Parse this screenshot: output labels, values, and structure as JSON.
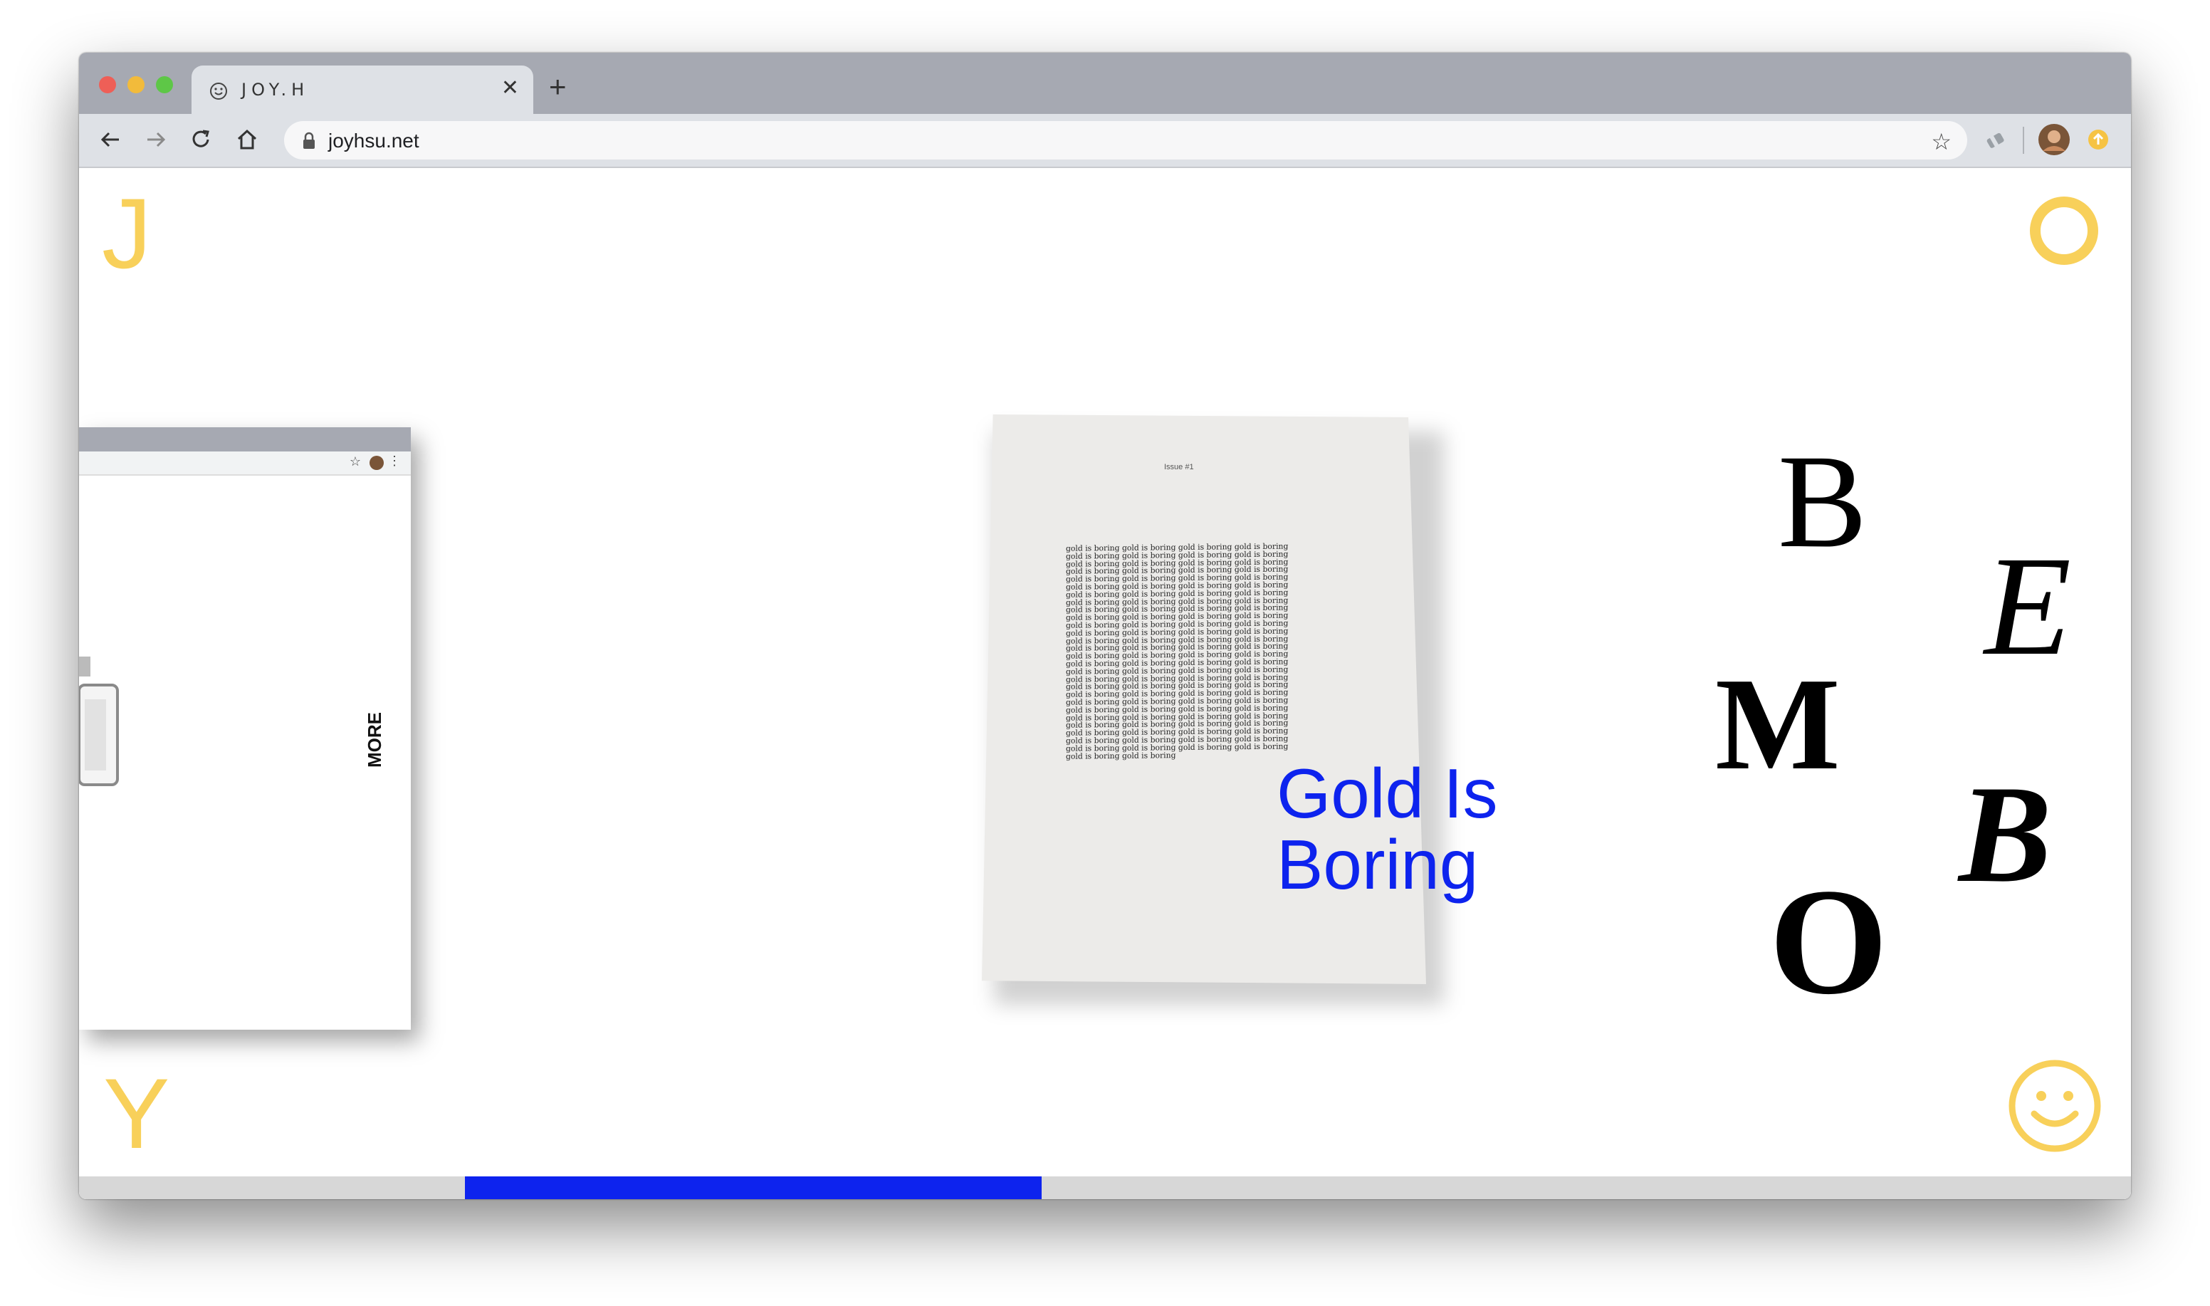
{
  "browser": {
    "tab_title": "JOY.H",
    "tab_favicon": "smiley-icon",
    "new_tab_label": "+",
    "close_label": "✕",
    "url": "joyhsu.net"
  },
  "colors": {
    "accent_yellow": "#f8d05a",
    "accent_blue": "#0d23ee",
    "progress_track": "#d7d7d7"
  },
  "page": {
    "corner_top_left": "J",
    "corner_bottom_left": "Y",
    "corner_top_right_icon": "ring-o-icon",
    "corner_bottom_right_icon": "smiley-icon"
  },
  "left_preview": {
    "side_label": "MORE"
  },
  "center_project": {
    "title": "Gold Is Boring",
    "issue_label": "Issue #1",
    "repeated_phrase": "gold is boring"
  },
  "right_project": {
    "letters": [
      "B",
      "E",
      "M",
      "B",
      "O"
    ]
  },
  "carousel": {
    "progress_start": 0.188,
    "progress_end": 0.469
  }
}
